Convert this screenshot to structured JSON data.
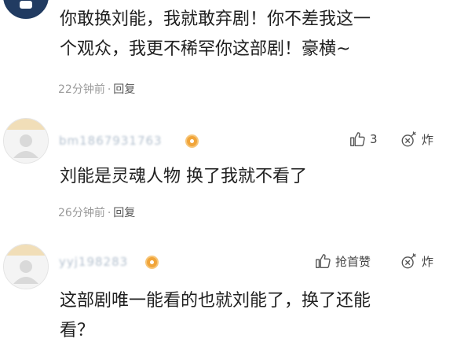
{
  "comments": [
    {
      "lines": [
        "你敢换刘能，我就敢弃剧！你不差我这一",
        "个观众，我更不稀罕你这部剧！豪横~"
      ],
      "time": "22分钟前",
      "reply": "回复"
    },
    {
      "username": "bm1867931763",
      "lines": [
        "刘能是灵魂人物 换了我就不看了"
      ],
      "time": "26分钟前",
      "reply": "回复",
      "like_label": "3",
      "bomb_label": "炸"
    },
    {
      "username": "yyj198283",
      "lines": [
        "这部剧唯一能看的也就刘能了，换了还能",
        "看？"
      ],
      "like_label": "抢首赞",
      "bomb_label": "炸"
    }
  ],
  "colors": {
    "text": "#1f1f1f",
    "meta": "#9a9a9a",
    "badge": "#f1a53a"
  }
}
